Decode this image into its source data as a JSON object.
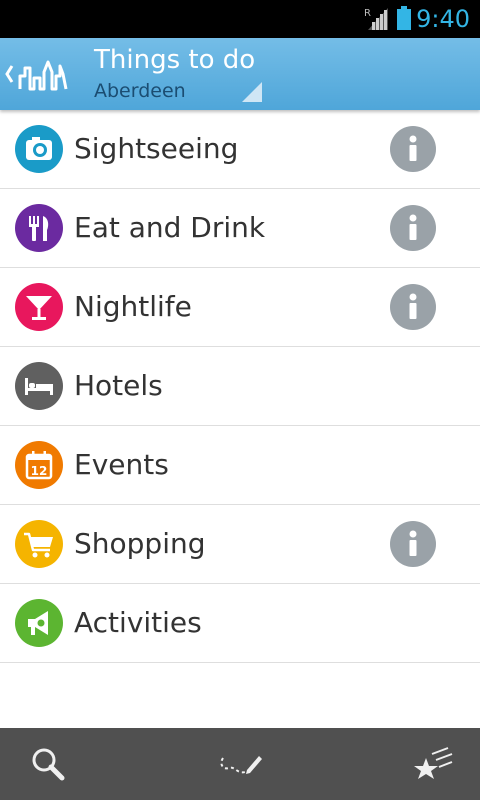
{
  "status_bar": {
    "time": "9:40",
    "roaming_indicator": "R",
    "icons": [
      "signal-icon",
      "battery-icon"
    ],
    "accent_color": "#33b5e5"
  },
  "action_bar": {
    "title": "Things to do",
    "subtitle": "Aberdeen",
    "icons": [
      "back-chevron-icon",
      "skyline-logo-icon",
      "spinner-triangle-icon"
    ],
    "background_color": "#5fb0e0"
  },
  "categories": [
    {
      "label": "Sightseeing",
      "icon": "camera-icon",
      "color": "#1a9bc8",
      "has_info": true
    },
    {
      "label": "Eat and Drink",
      "icon": "fork-knife-icon",
      "color": "#6b2aa0",
      "has_info": true
    },
    {
      "label": "Nightlife",
      "icon": "cocktail-icon",
      "color": "#e8175d",
      "has_info": true
    },
    {
      "label": "Hotels",
      "icon": "bed-icon",
      "color": "#606060",
      "has_info": false
    },
    {
      "label": "Events",
      "icon": "calendar-icon",
      "color": "#f07a00",
      "has_info": false,
      "icon_text": "12"
    },
    {
      "label": "Shopping",
      "icon": "shopping-cart-icon",
      "color": "#f5b400",
      "has_info": true
    },
    {
      "label": "Activities",
      "icon": "megaphone-icon",
      "color": "#5cb531",
      "has_info": false
    }
  ],
  "info_icon": "info-icon",
  "bottom_bar": {
    "buttons": [
      "search-icon",
      "trail-pencil-icon",
      "stars-icon"
    ]
  }
}
